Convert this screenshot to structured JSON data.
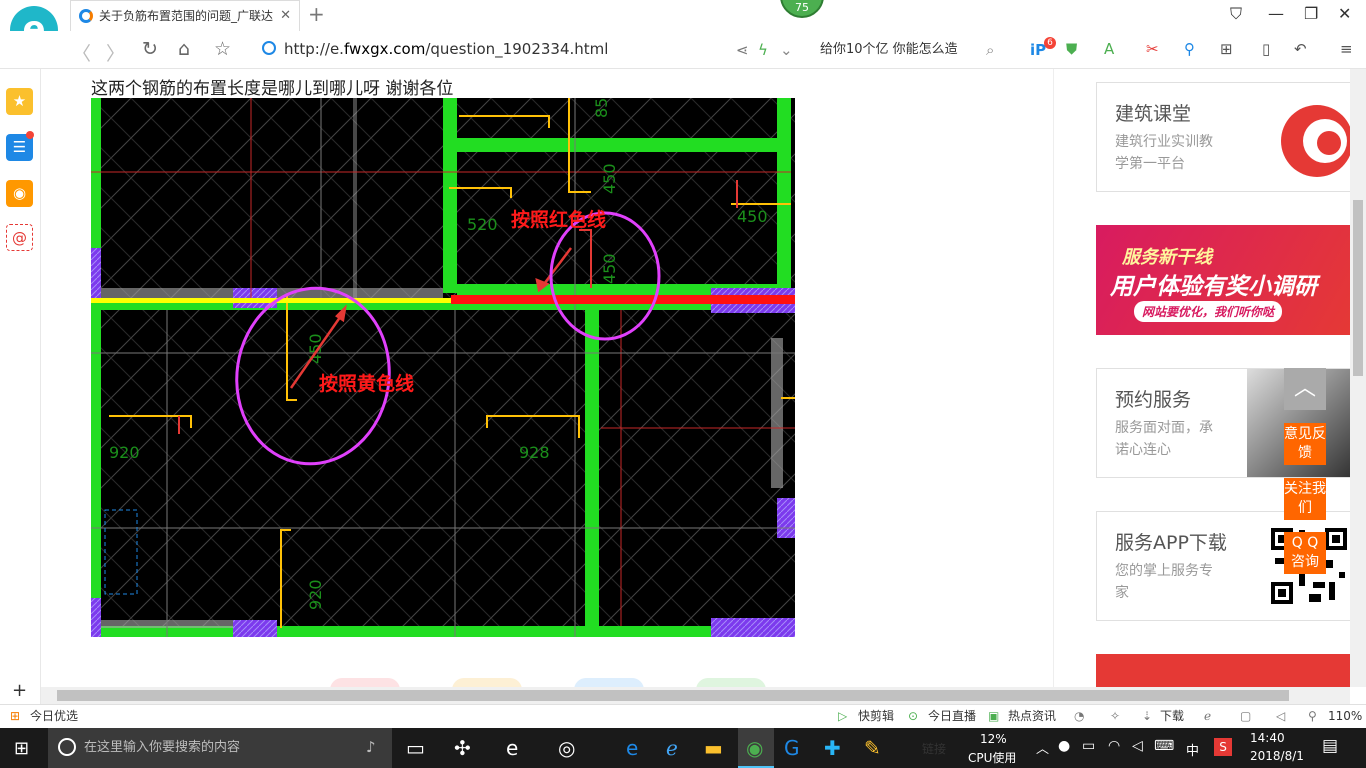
{
  "browser": {
    "tab_title": "关于负筋布置范围的问题_广联达",
    "tab_close": "✕",
    "new_tab": "+",
    "badge": "75",
    "url_prefix": "http://e.",
    "url_domain": "fwxgx.com",
    "url_path": "/question_1902334.html",
    "search_text": "给你10个亿 你能怎么造",
    "ext_badge": "6"
  },
  "page": {
    "question": "这两个钢筋的布置长度是哪儿到哪儿呀 谢谢各位"
  },
  "cad": {
    "annotation_red": "按照红色线",
    "annotation_yellow": "按照黄色线",
    "dims": [
      "850",
      "450",
      "450",
      "520",
      "920",
      "928",
      "450",
      "920",
      "450"
    ]
  },
  "sidebar": {
    "cards": [
      {
        "title": "建筑课堂",
        "desc": "建筑行业实训教学第一平台"
      },
      {
        "title": "预约服务",
        "desc": "服务面对面，承诺心连心"
      },
      {
        "title": "服务APP下载",
        "desc": "您的掌上服务专家"
      }
    ],
    "banner_line1": "服务新干线",
    "banner_line2": "用户体验有奖小调研",
    "banner_line3": "网站要优化，我们听你哒"
  },
  "float_buttons": [
    "意见反馈",
    "关注我们",
    "Q Q 咨询"
  ],
  "statusbar": {
    "left": "今日优选",
    "items": [
      "快剪辑",
      "今日直播",
      "热点资讯"
    ],
    "download": "下载",
    "zoom": "110%"
  },
  "taskbar": {
    "search_placeholder": "在这里输入你要搜索的内容",
    "links": "链接",
    "cpu_percent": "12%",
    "cpu_label": "CPU使用",
    "ime": "中",
    "time": "14:40",
    "date": "2018/8/1"
  }
}
